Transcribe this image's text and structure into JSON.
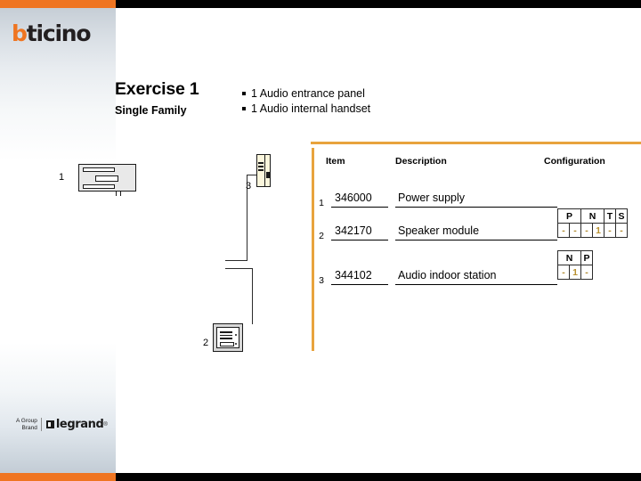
{
  "brand": {
    "logo_b": "b",
    "logo_rest": "ticino",
    "footer_group_line1": "A Group",
    "footer_group_line2": "Brand",
    "footer_word": "legrand",
    "footer_tm": "®"
  },
  "colors": {
    "accent_orange": "#ef7521",
    "rule_orange": "#e8a33d",
    "black": "#000000",
    "config_value": "#b08a2e"
  },
  "title": {
    "main": "Exercise 1",
    "sub": "Single Family"
  },
  "bullets": [
    "1 Audio entrance panel",
    "1 Audio internal handset"
  ],
  "table": {
    "headers": {
      "item": "Item",
      "description": "Description",
      "configuration": "Configuration"
    },
    "rows": [
      {
        "num": "1",
        "item": "346000",
        "description": "Power supply"
      },
      {
        "num": "2",
        "item": "342170",
        "description": "Speaker module"
      },
      {
        "num": "3",
        "item": "344102",
        "description": "Audio indoor station"
      }
    ]
  },
  "configurations": [
    {
      "for_row": "2",
      "headers": [
        "P",
        "N",
        "T",
        "S"
      ],
      "values": [
        "-",
        "-",
        "-",
        "1",
        "-",
        "-"
      ]
    },
    {
      "for_row": "3",
      "headers": [
        "N",
        "P"
      ],
      "values": [
        "-",
        "1",
        "-"
      ]
    }
  ],
  "diagram": {
    "labels": {
      "power_supply": "1",
      "entrance_panel": "2",
      "handset": "3"
    }
  }
}
